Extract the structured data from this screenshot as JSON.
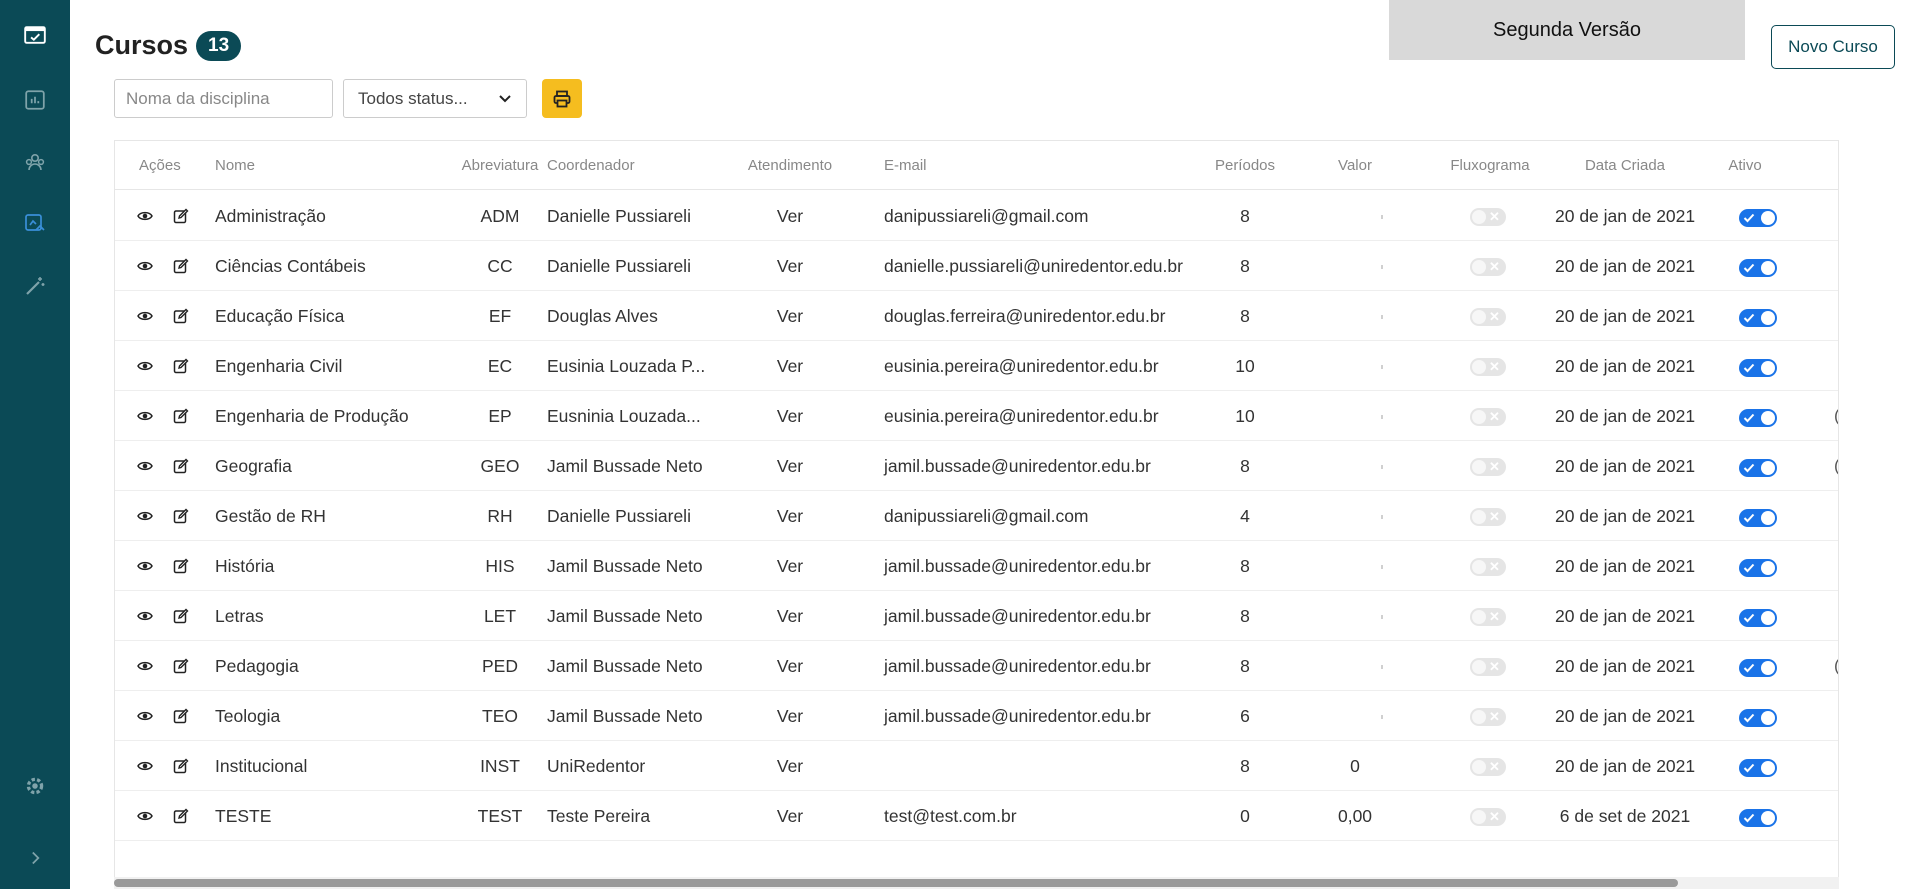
{
  "page": {
    "title": "Cursos",
    "count": "13",
    "version_label": "Segunda Versão",
    "new_course_label": "Novo Curso"
  },
  "filters": {
    "name_placeholder": "Noma da disciplina",
    "status_selected": "Todos status..."
  },
  "table": {
    "headers": {
      "actions": "Ações",
      "name": "Nome",
      "abbr": "Abreviatura",
      "coordinator": "Coordenador",
      "service": "Atendimento",
      "email": "E-mail",
      "periods": "Períodos",
      "value": "Valor",
      "flowchart": "Fluxograma",
      "created": "Data Criada",
      "active": "Ativo"
    },
    "rows": [
      {
        "name": "Administração",
        "abbr": "ADM",
        "coordinator": "Danielle Pussiareli",
        "service": "Ver",
        "email": "danipussiareli@gmail.com",
        "periods": "8",
        "value": "",
        "created": "20 de jan de 2021",
        "flowchart": false,
        "active": true,
        "extra": ""
      },
      {
        "name": "Ciências Contábeis",
        "abbr": "CC",
        "coordinator": "Danielle Pussiareli",
        "service": "Ver",
        "email": "danielle.pussiareli@uniredentor.edu.br",
        "periods": "8",
        "value": "",
        "created": "20 de jan de 2021",
        "flowchart": false,
        "active": true,
        "extra": ""
      },
      {
        "name": "Educação Física",
        "abbr": "EF",
        "coordinator": "Douglas Alves",
        "service": "Ver",
        "email": "douglas.ferreira@uniredentor.edu.br",
        "periods": "8",
        "value": "",
        "created": "20 de jan de 2021",
        "flowchart": false,
        "active": true,
        "extra": ""
      },
      {
        "name": "Engenharia Civil",
        "abbr": "EC",
        "coordinator": "Eusinia Louzada P...",
        "service": "Ver",
        "email": "eusinia.pereira@uniredentor.edu.br",
        "periods": "10",
        "value": "",
        "created": "20 de jan de 2021",
        "flowchart": false,
        "active": true,
        "extra": ""
      },
      {
        "name": "Engenharia de Produção",
        "abbr": "EP",
        "coordinator": "Eusninia Louzada...",
        "service": "Ver",
        "email": "eusinia.pereira@uniredentor.edu.br",
        "periods": "10",
        "value": "",
        "created": "20 de jan de 2021",
        "flowchart": false,
        "active": true,
        "extra": "("
      },
      {
        "name": "Geografia",
        "abbr": "GEO",
        "coordinator": "Jamil Bussade Neto",
        "service": "Ver",
        "email": "jamil.bussade@uniredentor.edu.br",
        "periods": "8",
        "value": "",
        "created": "20 de jan de 2021",
        "flowchart": false,
        "active": true,
        "extra": "("
      },
      {
        "name": "Gestão de RH",
        "abbr": "RH",
        "coordinator": "Danielle Pussiareli",
        "service": "Ver",
        "email": "danipussiareli@gmail.com",
        "periods": "4",
        "value": "",
        "created": "20 de jan de 2021",
        "flowchart": false,
        "active": true,
        "extra": ""
      },
      {
        "name": "História",
        "abbr": "HIS",
        "coordinator": "Jamil Bussade Neto",
        "service": "Ver",
        "email": "jamil.bussade@uniredentor.edu.br",
        "periods": "8",
        "value": "",
        "created": "20 de jan de 2021",
        "flowchart": false,
        "active": true,
        "extra": ""
      },
      {
        "name": "Letras",
        "abbr": "LET",
        "coordinator": "Jamil Bussade Neto",
        "service": "Ver",
        "email": "jamil.bussade@uniredentor.edu.br",
        "periods": "8",
        "value": "",
        "created": "20 de jan de 2021",
        "flowchart": false,
        "active": true,
        "extra": ""
      },
      {
        "name": "Pedagogia",
        "abbr": "PED",
        "coordinator": "Jamil Bussade Neto",
        "service": "Ver",
        "email": "jamil.bussade@uniredentor.edu.br",
        "periods": "8",
        "value": "",
        "created": "20 de jan de 2021",
        "flowchart": false,
        "active": true,
        "extra": "("
      },
      {
        "name": "Teologia",
        "abbr": "TEO",
        "coordinator": "Jamil Bussade Neto",
        "service": "Ver",
        "email": "jamil.bussade@uniredentor.edu.br",
        "periods": "6",
        "value": "",
        "created": "20 de jan de 2021",
        "flowchart": false,
        "active": true,
        "extra": ""
      },
      {
        "name": "Institucional",
        "abbr": "INST",
        "coordinator": "UniRedentor",
        "service": "Ver",
        "email": "",
        "periods": "8",
        "value": "0",
        "created": "20 de jan de 2021",
        "flowchart": false,
        "active": true,
        "extra": ""
      },
      {
        "name": "TESTE",
        "abbr": "TEST",
        "coordinator": "Teste Pereira",
        "service": "Ver",
        "email": "test@test.com.br",
        "periods": "0",
        "value": "0,00",
        "created": "6 de set de 2021",
        "flowchart": false,
        "active": true,
        "extra": ""
      }
    ]
  },
  "sidebar": {
    "icons": [
      "dashboard-icon",
      "report-icon",
      "users-icon",
      "courses-icon",
      "magic-wand-icon",
      "settings-icon",
      "chevron-right-icon"
    ]
  },
  "colors": {
    "sidebar": "#0b4a56",
    "accent": "#1a73e8",
    "print_button": "#f5bd1f"
  }
}
